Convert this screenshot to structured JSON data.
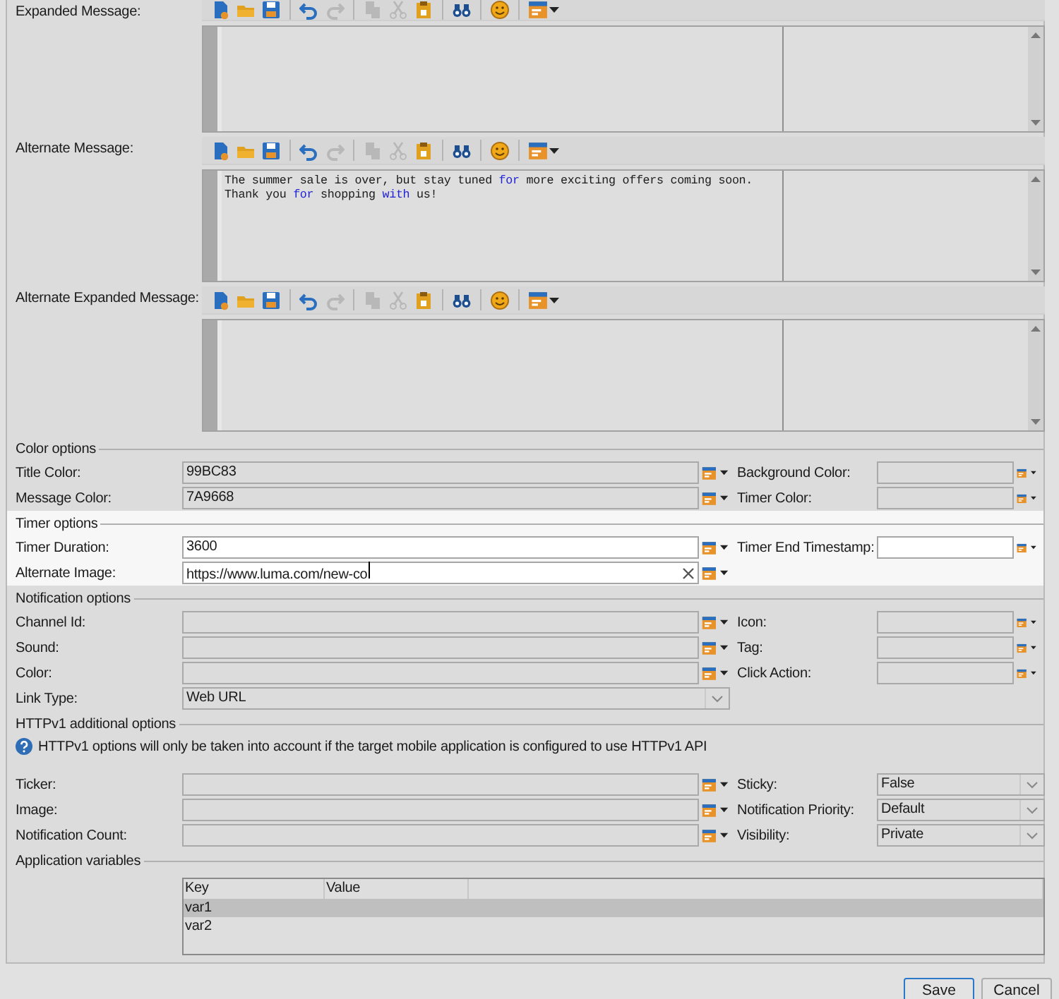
{
  "editors": [
    {
      "label": "Expanded Message:",
      "toolbar": [
        {
          "disabled": false
        },
        {
          "disabled": false
        },
        {
          "disabled": false
        },
        {
          "disabled": false
        },
        {
          "disabled": true
        },
        {
          "disabled": true
        },
        {
          "disabled": true
        },
        {
          "disabled": false
        },
        {
          "disabled": false
        },
        {
          "disabled": false
        },
        {
          "disabled": false
        }
      ]
    },
    {
      "label": "Alternate Message:",
      "toolbar": [
        {
          "disabled": false
        },
        {
          "disabled": false
        },
        {
          "disabled": false
        },
        {
          "disabled": false
        },
        {
          "disabled": true
        },
        {
          "disabled": true
        },
        {
          "disabled": true
        },
        {
          "disabled": false
        },
        {
          "disabled": false
        },
        {
          "disabled": false
        },
        {
          "disabled": false
        }
      ],
      "lines": [
        [
          {
            "kind": "plain",
            "text": "The summer sale is over, but stay tuned "
          },
          {
            "kind": "keyword",
            "text": "for"
          },
          {
            "kind": "plain",
            "text": " more exciting offers coming soon."
          }
        ],
        [
          {
            "kind": "plain",
            "text": "Thank you "
          },
          {
            "kind": "keyword",
            "text": "for"
          },
          {
            "kind": "plain",
            "text": " shopping "
          },
          {
            "kind": "keyword",
            "text": "with"
          },
          {
            "kind": "plain",
            "text": " us!"
          }
        ]
      ]
    },
    {
      "label": "Alternate Expanded Message:",
      "toolbar": [
        {
          "disabled": false
        },
        {
          "disabled": false
        },
        {
          "disabled": false
        },
        {
          "disabled": false
        },
        {
          "disabled": true
        },
        {
          "disabled": true
        },
        {
          "disabled": true
        },
        {
          "disabled": false
        },
        {
          "disabled": false
        },
        {
          "disabled": false
        },
        {
          "disabled": false
        }
      ]
    }
  ],
  "sections": [
    {
      "title": "Color options",
      "highlighted": false,
      "rows": [
        {
          "left": {
            "label": "Title Color:",
            "kind": "picker",
            "value": "99BC83",
            "disabled": true
          },
          "right": {
            "label": "Background Color:",
            "kind": "picker",
            "disabled": true
          }
        },
        {
          "left": {
            "label": "Message Color:",
            "kind": "picker",
            "value": "7A9668",
            "disabled": true
          },
          "right": {
            "label": "Timer Color:",
            "kind": "picker",
            "disabled": true
          }
        }
      ]
    },
    {
      "title": "Timer options",
      "highlighted": true,
      "rows": [
        {
          "left": {
            "label": "Timer Duration:",
            "kind": "picker",
            "value": "3600",
            "disabled": false
          },
          "right": {
            "label": "Timer End Timestamp:",
            "kind": "picker",
            "disabled": false
          }
        },
        {
          "left": {
            "label": "Alternate Image:",
            "kind": "clearable",
            "value": "https://www.luma.com/new-co",
            "disabled": false,
            "focused": true
          }
        }
      ]
    },
    {
      "title": "Notification options",
      "highlighted": false,
      "rows": [
        {
          "left": {
            "label": "Channel Id:",
            "kind": "picker",
            "disabled": true
          },
          "right": {
            "label": "Icon:",
            "kind": "picker",
            "disabled": true
          }
        },
        {
          "left": {
            "label": "Sound:",
            "kind": "picker",
            "disabled": true
          },
          "right": {
            "label": "Tag:",
            "kind": "picker",
            "disabled": true
          }
        },
        {
          "left": {
            "label": "Color:",
            "kind": "picker",
            "disabled": true
          },
          "right": {
            "label": "Click Action:",
            "kind": "picker",
            "disabled": true
          }
        },
        {
          "left": {
            "label": "Link Type:",
            "kind": "select",
            "value": "Web URL",
            "disabled": true
          }
        }
      ]
    },
    {
      "title": "HTTPv1 additional options",
      "highlighted": false,
      "note": "HTTPv1 options will only be taken into account if the target mobile application is configured to use HTTPv1 API",
      "rows": [
        {
          "left": {
            "label": "Ticker:",
            "kind": "picker",
            "disabled": true
          },
          "right": {
            "label": "Sticky:",
            "kind": "select",
            "value": "False",
            "disabled": true
          }
        },
        {
          "left": {
            "label": "Image:",
            "kind": "picker",
            "disabled": true
          },
          "right": {
            "label": "Notification Priority:",
            "kind": "select",
            "value": "Default",
            "disabled": true
          }
        },
        {
          "left": {
            "label": "Notification Count:",
            "kind": "picker",
            "disabled": true
          },
          "right": {
            "label": "Visibility:",
            "kind": "select",
            "value": "Private",
            "disabled": true
          }
        }
      ]
    },
    {
      "title": "Application variables",
      "highlighted": false,
      "table": {
        "columns": [
          "Key",
          "Value"
        ],
        "rows": [
          {
            "key": "var1",
            "selected": true
          },
          {
            "key": "var2",
            "selected": false
          }
        ]
      }
    }
  ],
  "buttons": [
    {
      "label": "Save",
      "default": true
    },
    {
      "label": "Cancel",
      "default": false
    }
  ]
}
